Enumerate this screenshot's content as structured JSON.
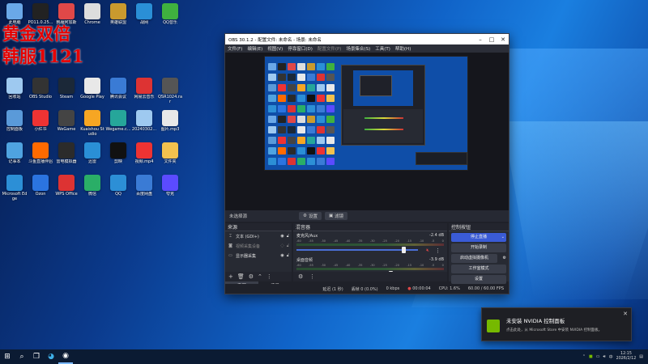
{
  "overlay": {
    "line1": "黄金双倍",
    "line2": "韩服1121"
  },
  "desktop_icons": [
    {
      "label": "此电脑",
      "color": "#6aa8e8"
    },
    {
      "label": "PO11.0.25...",
      "color": "#222"
    },
    {
      "label": "韩服阿加斯",
      "color": "#e04848"
    },
    {
      "label": "Chrome",
      "color": "#ddd"
    },
    {
      "label": "英雄联盟",
      "color": "#c99a2e"
    },
    {
      "label": "战网",
      "color": "#2a8fd6"
    },
    {
      "label": "QQ音乐",
      "color": "#3fb13f"
    },
    {
      "label": "回收站",
      "color": "#9ec9f0"
    },
    {
      "label": "OBS Studio",
      "color": "#333"
    },
    {
      "label": "Steam",
      "color": "#1b2838"
    },
    {
      "label": "Google Play",
      "color": "#e8e8e8"
    },
    {
      "label": "腾讯会议",
      "color": "#3a7bd5"
    },
    {
      "label": "网易云音乐",
      "color": "#d33"
    },
    {
      "label": "QSR1024.rar",
      "color": "#555"
    },
    {
      "label": "控制面板",
      "color": "#5a9ad9"
    },
    {
      "label": "小红书",
      "color": "#e33"
    },
    {
      "label": "WeGame",
      "color": "#444"
    },
    {
      "label": "Kuaishou Studio",
      "color": "#f6a623"
    },
    {
      "label": "Wegame.c...",
      "color": "#26a69a"
    },
    {
      "label": "20240302...",
      "color": "#9ec9f0"
    },
    {
      "label": "图片.mp3",
      "color": "#e8e8e8"
    },
    {
      "label": "记事本",
      "color": "#4fa3e0"
    },
    {
      "label": "斗鱼直播伴侣",
      "color": "#ff6a00"
    },
    {
      "label": "雷电模拟器",
      "color": "#2b2b2b"
    },
    {
      "label": "迅雷",
      "color": "#2a8fd6"
    },
    {
      "label": "剪映",
      "color": "#111"
    },
    {
      "label": "视频.mp4",
      "color": "#e33"
    },
    {
      "label": "文件夹",
      "color": "#f2c14e"
    },
    {
      "label": "Microsoft Edge",
      "color": "#2c8fd6"
    },
    {
      "label": "Ozon",
      "color": "#2b74e0"
    },
    {
      "label": "WPS Office",
      "color": "#d33"
    },
    {
      "label": "微信",
      "color": "#2aae67"
    },
    {
      "label": "QQ",
      "color": "#2c8fd6"
    },
    {
      "label": "百度网盘",
      "color": "#3a7bd5"
    },
    {
      "label": "夸克",
      "color": "#5b4bff"
    }
  ],
  "obs": {
    "title": "OBS 30.1.2 - 配置文件: 未命名 - 场景: 未命名",
    "menu": [
      "文件(F)",
      "编辑(E)",
      "视图(V)",
      "停靠窗口(D)",
      "配置文件(P)",
      "场景集合(S)",
      "工具(T)",
      "帮助(H)"
    ],
    "toolbar": {
      "no_source": "未选择源",
      "settings": "设置",
      "filters": "滤镜"
    },
    "sources": {
      "title": "来源",
      "items": [
        {
          "name": "文本 (GDI+)",
          "icon": "text-icon"
        },
        {
          "name": "视频采集设备",
          "icon": "camera-icon"
        },
        {
          "name": "显示器采集",
          "icon": "monitor-icon"
        }
      ]
    },
    "tabs": {
      "sources": "来源",
      "scenes": "场景"
    },
    "mixer": {
      "title": "混音器",
      "channels": [
        {
          "name": "麦克风/Aux",
          "db": "-2.4 dB",
          "level": 0.88,
          "muted": true
        },
        {
          "name": "桌面音频",
          "db": "-3.9 dB",
          "level": 0.77,
          "muted": false
        }
      ],
      "scale": [
        "-60",
        "-55",
        "-50",
        "-45",
        "-40",
        "-35",
        "-30",
        "-25",
        "-20",
        "-15",
        "-10",
        "-5",
        "0"
      ]
    },
    "controls": {
      "title": "控制按钮",
      "buttons": [
        "停止直播",
        "开始录制",
        "启动虚拟摄像机",
        "工作室模式",
        "设置",
        "退出"
      ]
    },
    "status": {
      "latency": "延迟 (1 秒)",
      "dropped": "丢帧 0 (0.0%)",
      "bitrate": "0 kbps",
      "time": "00:00:04",
      "cpu": "CPU: 1.6%",
      "fps": "60.00 / 60.00 FPS"
    }
  },
  "notification": {
    "title": "未安装 NVIDIA 控制面板",
    "body": "点击此处，从 Microsoft Store 中安装 NVIDIA 控制面板。"
  },
  "taskbar": {
    "time": "12:15",
    "date": "2026/2/12",
    "lang": "中"
  }
}
